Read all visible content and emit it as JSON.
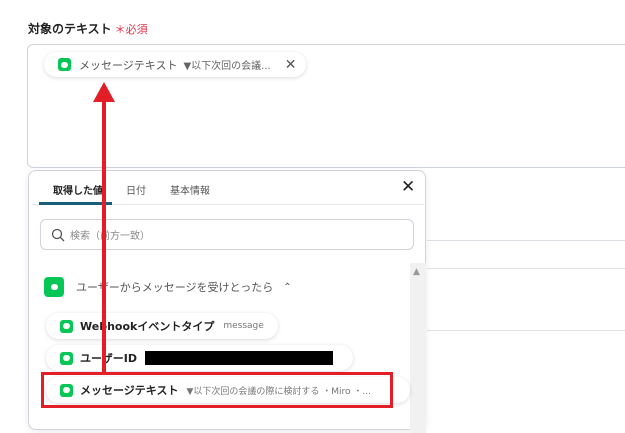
{
  "field": {
    "label": "対象のテキスト",
    "required": "＊必須",
    "chip": {
      "label": "メッセージテキスト",
      "value": "▼以下次回の会議..."
    }
  },
  "popup": {
    "tabs": [
      {
        "label": "取得した値",
        "active": true
      },
      {
        "label": "日付"
      },
      {
        "label": "基本情報"
      }
    ],
    "search_placeholder": "検索（前方一致）",
    "group": {
      "label": "ユーザーからメッセージを受けとったら",
      "expanded": true
    },
    "items": [
      {
        "label": "Webhookイベントタイプ",
        "value": "message"
      },
      {
        "label": "ユーザーID",
        "value": "",
        "redacted": true
      },
      {
        "label": "メッセージテキスト",
        "value": "▼以下次回の会議の際に検討する ・Miro ・...",
        "highlighted": true
      }
    ]
  },
  "colors": {
    "accent": "#1a5f7a",
    "line_green": "#06c755",
    "annotation_red": "#e41e26",
    "required_red": "#e5334a"
  }
}
